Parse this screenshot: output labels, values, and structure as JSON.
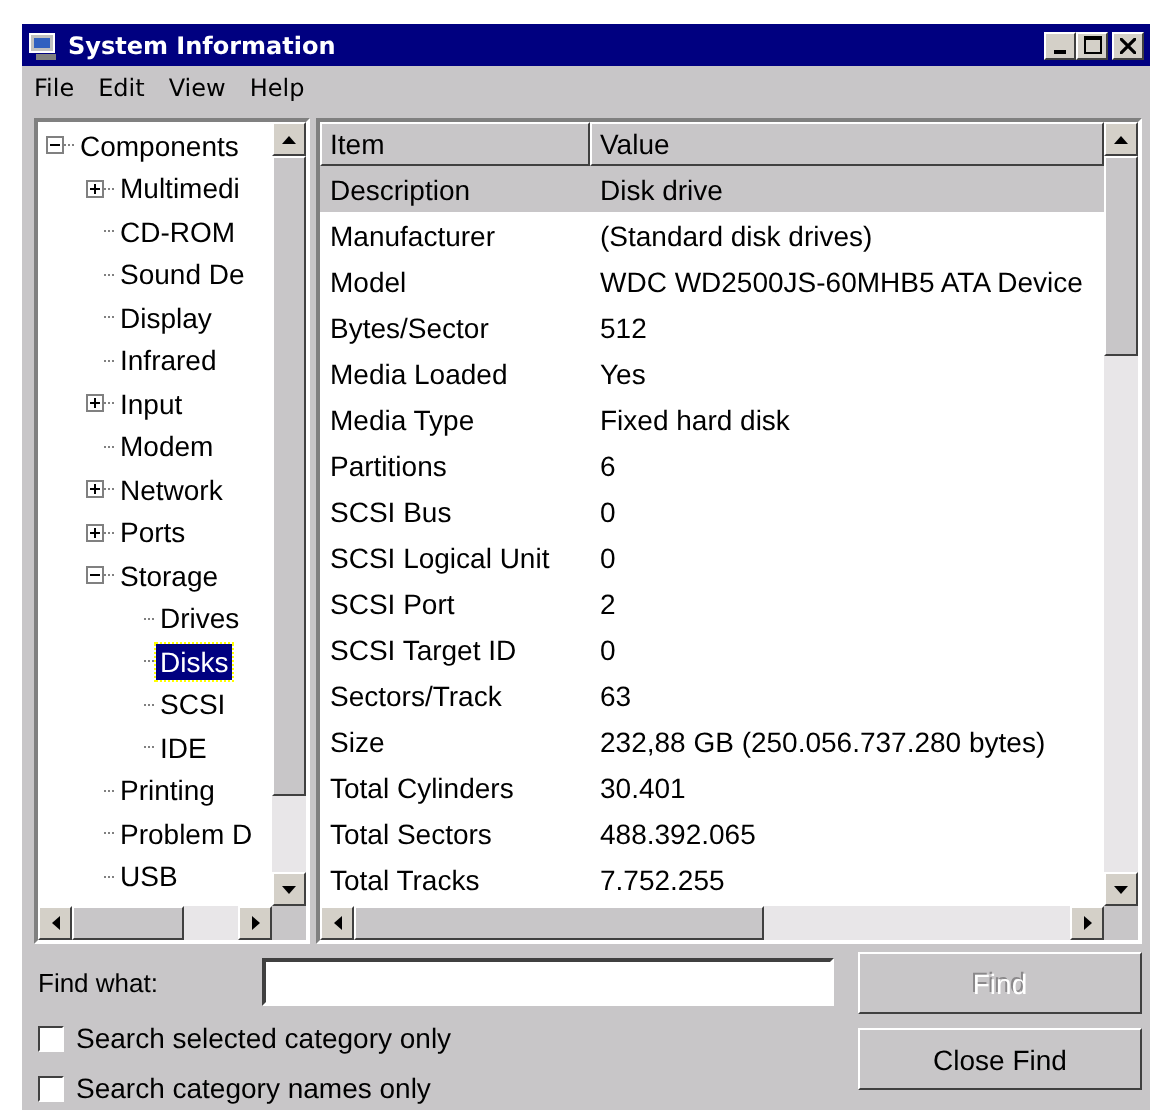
{
  "window": {
    "title": "System Information"
  },
  "menu": [
    "File",
    "Edit",
    "View",
    "Help"
  ],
  "tree": [
    {
      "label": "Components",
      "kind": "expanded",
      "selected": false,
      "children": [
        {
          "label": "Multimedi",
          "kind": "collapsed",
          "selected": false
        },
        {
          "label": "CD-ROM",
          "kind": "leaf",
          "selected": false
        },
        {
          "label": "Sound De",
          "kind": "leaf",
          "selected": false
        },
        {
          "label": "Display",
          "kind": "leaf",
          "selected": false
        },
        {
          "label": "Infrared",
          "kind": "leaf",
          "selected": false
        },
        {
          "label": "Input",
          "kind": "collapsed",
          "selected": false
        },
        {
          "label": "Modem",
          "kind": "leaf",
          "selected": false
        },
        {
          "label": "Network",
          "kind": "collapsed",
          "selected": false
        },
        {
          "label": "Ports",
          "kind": "collapsed",
          "selected": false
        },
        {
          "label": "Storage",
          "kind": "expanded",
          "selected": false,
          "children": [
            {
              "label": "Drives",
              "kind": "leaf",
              "selected": false
            },
            {
              "label": "Disks",
              "kind": "leaf",
              "selected": true
            },
            {
              "label": "SCSI",
              "kind": "leaf",
              "selected": false
            },
            {
              "label": "IDE",
              "kind": "leaf",
              "selected": false
            }
          ]
        },
        {
          "label": "Printing",
          "kind": "leaf",
          "selected": false
        },
        {
          "label": "Problem D",
          "kind": "leaf",
          "selected": false
        },
        {
          "label": "USB",
          "kind": "leaf",
          "selected": false
        }
      ]
    }
  ],
  "table": {
    "columns": [
      "Item",
      "Value"
    ],
    "rows": [
      {
        "item": "Description",
        "value": "Disk drive",
        "selected": true
      },
      {
        "item": "Manufacturer",
        "value": "(Standard disk drives)",
        "selected": false
      },
      {
        "item": "Model",
        "value": "WDC WD2500JS-60MHB5 ATA Device",
        "selected": false
      },
      {
        "item": "Bytes/Sector",
        "value": "512",
        "selected": false
      },
      {
        "item": "Media Loaded",
        "value": "Yes",
        "selected": false
      },
      {
        "item": "Media Type",
        "value": "Fixed hard disk",
        "selected": false
      },
      {
        "item": "Partitions",
        "value": "6",
        "selected": false
      },
      {
        "item": "SCSI Bus",
        "value": "0",
        "selected": false
      },
      {
        "item": "SCSI Logical Unit",
        "value": "0",
        "selected": false
      },
      {
        "item": "SCSI Port",
        "value": "2",
        "selected": false
      },
      {
        "item": "SCSI Target ID",
        "value": "0",
        "selected": false
      },
      {
        "item": "Sectors/Track",
        "value": "63",
        "selected": false
      },
      {
        "item": "Size",
        "value": "232,88 GB (250.056.737.280 bytes)",
        "selected": false
      },
      {
        "item": "Total Cylinders",
        "value": "30.401",
        "selected": false
      },
      {
        "item": "Total Sectors",
        "value": "488.392.065",
        "selected": false
      },
      {
        "item": "Total Tracks",
        "value": "7.752.255",
        "selected": false
      }
    ]
  },
  "find": {
    "label": "Find what:",
    "find_button": {
      "label": "Find",
      "disabled": true
    },
    "close_button": {
      "label": "Close Find",
      "disabled": false
    },
    "options": [
      {
        "label": "Search selected category only",
        "checked": false
      },
      {
        "label": "Search category names only",
        "checked": false
      }
    ]
  }
}
